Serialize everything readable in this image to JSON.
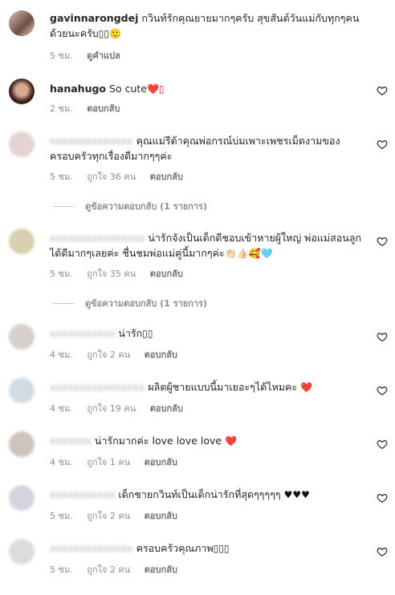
{
  "comments": [
    {
      "username": "gavinnarongdej",
      "text": "กวินท์รักคุณยายมากๆครับ สุขสันต์วันแม่กับทุกๆคนด้วยนะครับ",
      "suffix": "▯▯🙂",
      "time": "5 ชม.",
      "likes": "",
      "actions": [
        "ดูคำแปล"
      ]
    },
    {
      "username": "hanahugo",
      "text": "So cute",
      "suffix": "❤️▯",
      "time": "2 ชม.",
      "likes": "",
      "actions": [
        "ตอบกลับ"
      ]
    },
    {
      "username": "",
      "text": "คุณแม่รีต้าคุณพ่อกรณ์บ่มเพาะเพชรเม็ดงามของครอบครัวทุกเรื่องดีมากๆๆค่ะ",
      "suffix": "",
      "time": "5 ชม.",
      "likes": "ถูกใจ 36 คน",
      "actions": [
        "ตอบกลับ"
      ],
      "replies": "ดูข้อความตอบกลับ (1 รายการ)"
    },
    {
      "username": "",
      "text": "น่ารักจังเป็นเด็กดีชอบเข้าหายผู้ใหญ่ พ่อแม่สอนลูกได้ดีมากๆเลยค่ะ ชื่นชมพ่อแม่คู่นี้มากๆค่ะ",
      "suffix": "👏🏻👍🏻🥰🩵",
      "time": "5 ชม.",
      "likes": "ถูกใจ 35 คน",
      "actions": [
        "ตอบกลับ"
      ],
      "replies": "ดูข้อความตอบกลับ (1 รายการ)"
    },
    {
      "username": "",
      "text": "น่ารัก",
      "suffix": "▯▯",
      "time": "4 ชม.",
      "likes": "ถูกใจ 2 คน",
      "actions": [
        "ตอบกลับ"
      ]
    },
    {
      "username": "",
      "text": "ผลิตผู้ชายแบบนี้มาเยอะๆได้ไหมคะ",
      "suffix": "❤️",
      "time": "4 ชม.",
      "likes": "ถูกใจ 19 คน",
      "actions": [
        "ตอบกลับ"
      ]
    },
    {
      "username": "",
      "text": "น่ารักมากค่ะ love love love",
      "suffix": "❤️",
      "time": "4 ชม.",
      "likes": "ถูกใจ 1 คน",
      "actions": [
        "ตอบกลับ"
      ]
    },
    {
      "username": "",
      "text": "เด็กชายกวินท์เป็นเด็กน่ารักที่สุดๆๆๆๆๆ",
      "suffix": "♥♥♥",
      "time": "5 ชม.",
      "likes": "ถูกใจ 2 คน",
      "actions": [
        "ตอบกลับ"
      ]
    },
    {
      "username": "",
      "text": "ครอบครัวคุณภาพ",
      "suffix": "▯▯▯",
      "time": "5 ชม.",
      "likes": "ถูกใจ 2 คน",
      "actions": [
        "ตอบกลับ"
      ]
    }
  ],
  "colors": {
    "heart": "#c8102e",
    "text": "#262626",
    "meta": "#8e8e8e"
  }
}
